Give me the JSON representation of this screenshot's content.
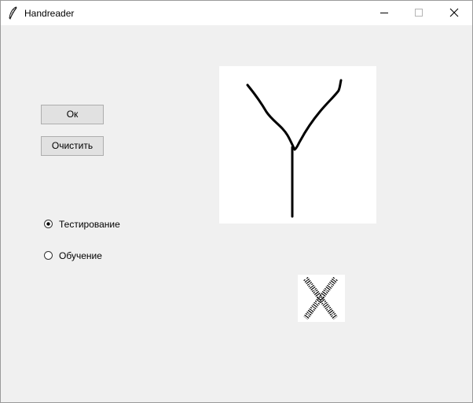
{
  "window": {
    "title": "Handreader",
    "app_icon": "feather-icon",
    "controls": [
      "minimize-icon",
      "maximize-icon",
      "close-icon"
    ]
  },
  "buttons": {
    "ok_label": "Ок",
    "clear_label": "Очистить"
  },
  "mode": {
    "options": [
      {
        "label": "Тестирование",
        "selected": true
      },
      {
        "label": "Обучение",
        "selected": false
      }
    ]
  },
  "canvas": {
    "background": "#ffffff",
    "stroke_color": "#000000",
    "drawing": "letter-Y-stroke"
  },
  "preview": {
    "background": "#ffffff",
    "glyph": "dotted-x-mark"
  },
  "colors": {
    "window_bg": "#f0f0f0",
    "titlebar_bg": "#ffffff",
    "button_bg": "#e1e1e1",
    "button_border": "#adadad"
  }
}
